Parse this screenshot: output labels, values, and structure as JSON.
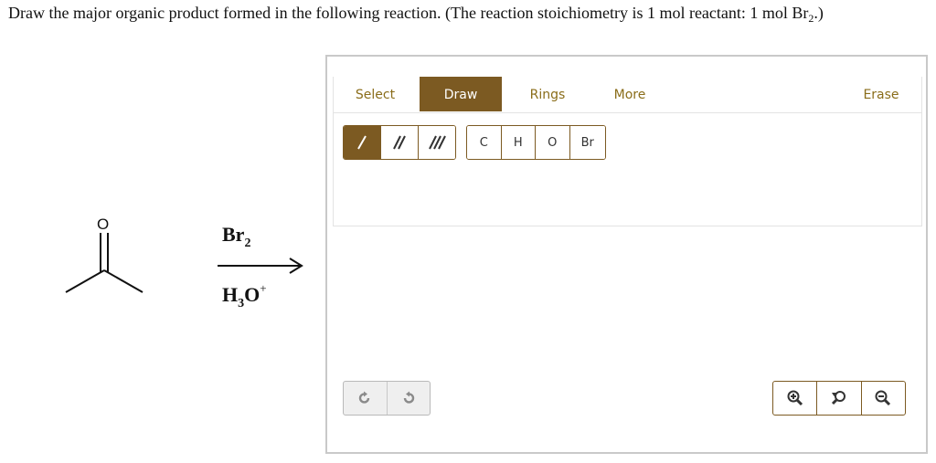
{
  "question": {
    "text": "Draw the major organic product formed in the following reaction. (The reaction stoichiometry is 1 mol reactant: 1 mol Br",
    "subscript": "2",
    "end": ".)"
  },
  "reaction": {
    "reactant_atom": "O",
    "reagent_top": {
      "main": "Br",
      "sub": "2"
    },
    "reagent_bottom": {
      "main_a": "H",
      "sub": "3",
      "main_b": "O",
      "sup": "+"
    }
  },
  "toolbar": {
    "tabs": [
      {
        "label": "Select"
      },
      {
        "label": "Draw"
      },
      {
        "label": "Rings"
      },
      {
        "label": "More"
      },
      {
        "label": "Erase"
      }
    ],
    "atoms": [
      "C",
      "H",
      "O",
      "Br"
    ]
  },
  "colors": {
    "accent": "#7c5a22",
    "tab_text": "#8a6d1a",
    "border": "#c9c9c9"
  },
  "icons": {
    "bonds": [
      "single-bond-icon",
      "double-bond-icon",
      "triple-bond-icon"
    ],
    "undo": "undo-icon",
    "redo": "redo-icon",
    "zoom": [
      "zoom-in-icon",
      "zoom-reset-icon",
      "zoom-out-icon"
    ]
  }
}
